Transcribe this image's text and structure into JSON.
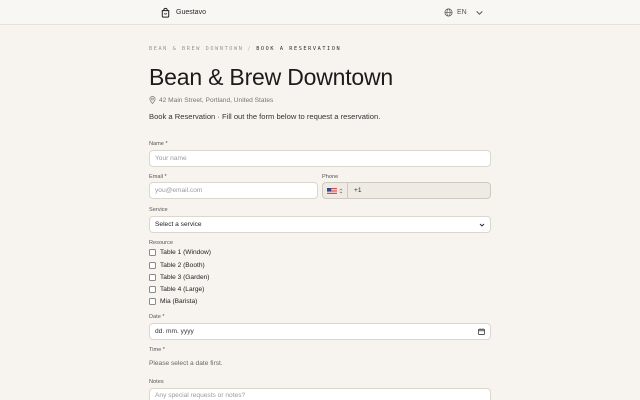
{
  "header": {
    "brand_name": "Guestavo",
    "language": "EN"
  },
  "breadcrumb": {
    "parent": "BEAN & BREW DOWNTOWN",
    "separator": "/",
    "current": "BOOK A RESERVATION"
  },
  "venue": {
    "title": "Bean & Brew Downtown",
    "address": "42 Main Street, Portland, United States"
  },
  "intro": "Book a Reservation · Fill out the form below to request a reservation.",
  "form": {
    "name": {
      "label": "Name *",
      "placeholder": "Your name"
    },
    "email": {
      "label": "Email *",
      "placeholder": "you@email.com"
    },
    "phone": {
      "label": "Phone",
      "country_code": "+1",
      "country_flag": "us-flag-icon"
    },
    "service": {
      "label": "Service",
      "selected": "Select a service"
    },
    "resource": {
      "label": "Resource",
      "options": [
        "Table 1 (Window)",
        "Table 2 (Booth)",
        "Table 3 (Garden)",
        "Table 4 (Large)",
        "Mia (Barista)"
      ]
    },
    "date": {
      "label": "Date *",
      "placeholder": "dd. mm. yyyy"
    },
    "time": {
      "label": "Time *",
      "hint": "Please select a date first."
    },
    "notes": {
      "label": "Notes",
      "placeholder": "Any special requests or notes?"
    }
  },
  "colors": {
    "background": "#f7f4ef",
    "field_background": "#ffffff",
    "field_border": "#dcd7ce",
    "text": "#1f1f1f"
  }
}
